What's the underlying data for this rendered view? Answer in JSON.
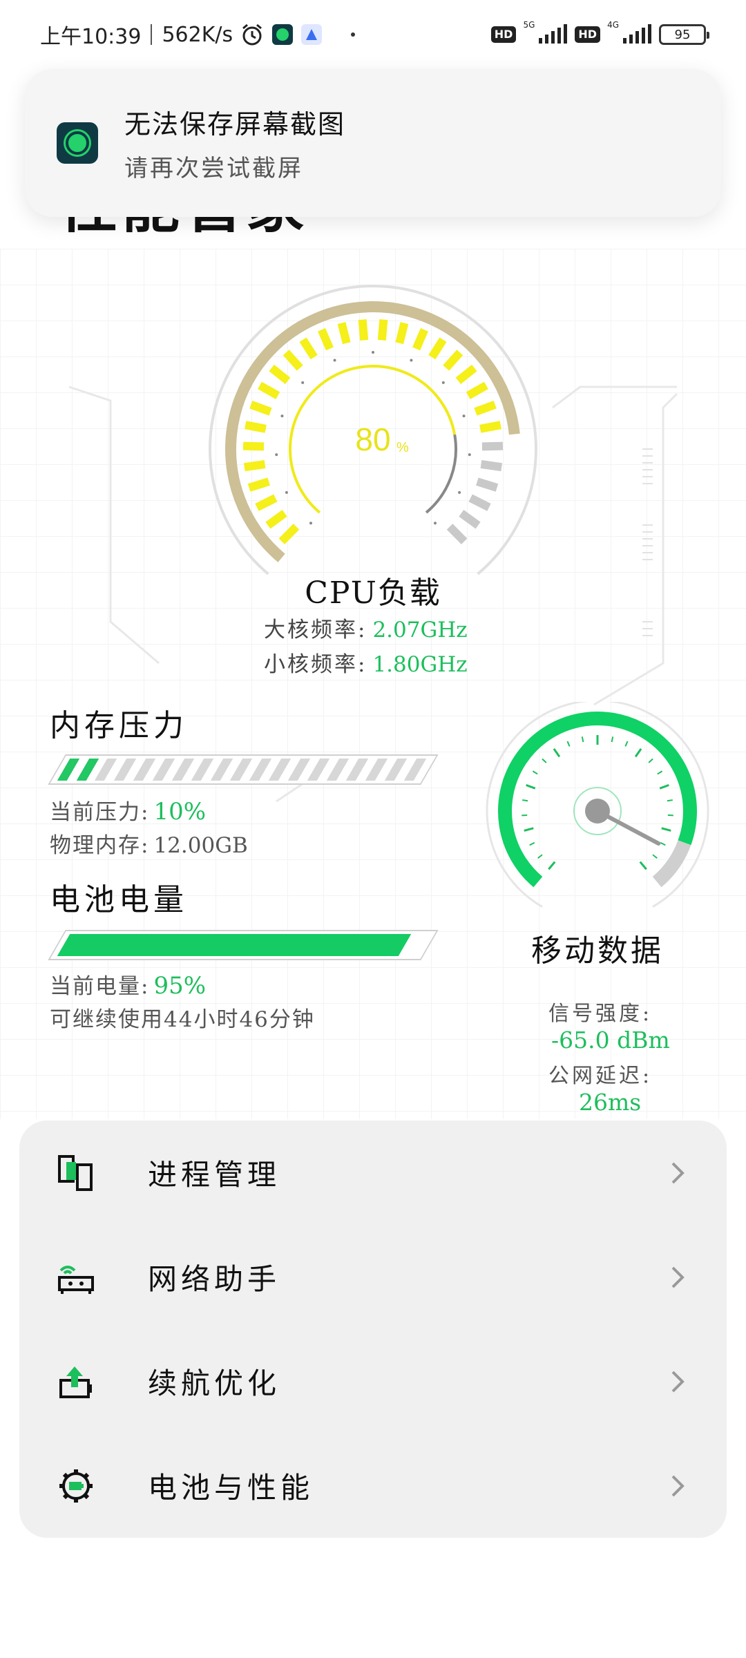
{
  "status_bar": {
    "time": "上午10:39",
    "net_speed": "562K/s",
    "hd_badge": "HD",
    "net_5g": "5G",
    "net_4g": "4G",
    "battery": "95",
    "icons": [
      "alarm-icon",
      "app-notify-icon",
      "tool-notify-icon",
      "dot-icon",
      "signal-5g-icon",
      "signal-4g-icon",
      "battery-icon"
    ]
  },
  "page": {
    "title": "性能管家"
  },
  "toast": {
    "title": "无法保存屏幕截图",
    "subtitle": "请再次尝试截屏"
  },
  "cpu": {
    "load_value": "80",
    "load_unit": "%",
    "load_fraction": 0.8,
    "title": "CPU负载",
    "big_core_label": "大核频率:",
    "big_core_value": "2.07GHz",
    "small_core_label": "小核频率:",
    "small_core_value": "1.80GHz",
    "accent": "#f5ef1a",
    "track": "#cdbf96"
  },
  "memory": {
    "title": "内存压力",
    "pressure_label": "当前压力:",
    "pressure_value": "10%",
    "pressure_fraction": 0.1,
    "physical_label": "物理内存:",
    "physical_value": "12.00GB"
  },
  "battery": {
    "title": "电池电量",
    "level_label": "当前电量:",
    "level_value": "95%",
    "level_fraction": 0.95,
    "remaining": "可继续使用44小时46分钟"
  },
  "mobile_data": {
    "title": "移动数据",
    "signal_label": "信号强度:",
    "signal_value": "-65.0 dBm",
    "latency_label": "公网延迟:",
    "latency_value": "26ms",
    "accent": "#0fd165"
  },
  "menu": {
    "items": [
      {
        "label": "进程管理",
        "icon": "process-icon"
      },
      {
        "label": "网络助手",
        "icon": "router-icon"
      },
      {
        "label": "续航优化",
        "icon": "battery-boost-icon"
      },
      {
        "label": "电池与性能",
        "icon": "gear-battery-icon"
      }
    ]
  }
}
